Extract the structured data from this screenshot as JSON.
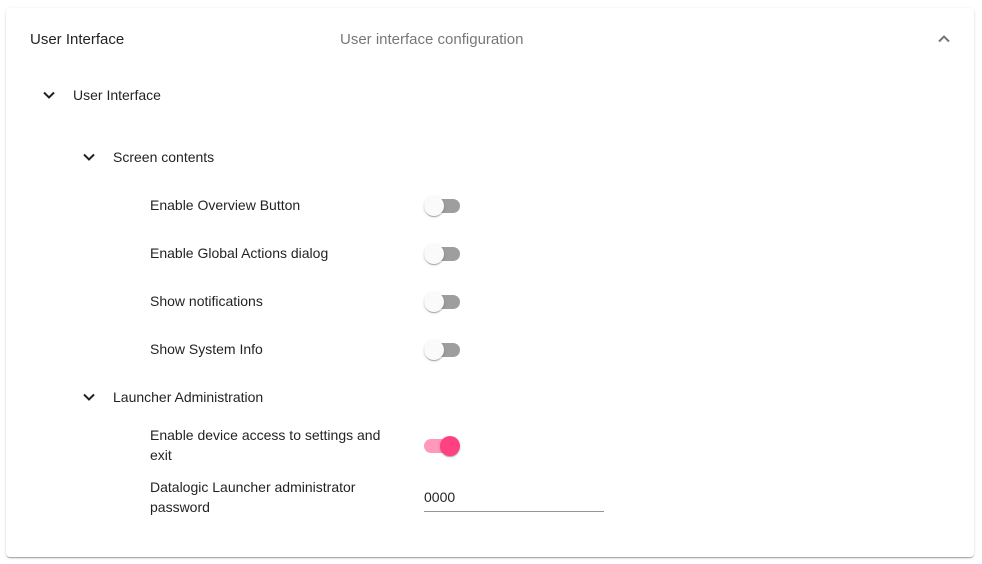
{
  "panel": {
    "title": "User Interface",
    "description": "User interface configuration"
  },
  "group": {
    "label": "User Interface"
  },
  "sections": {
    "screen_contents": {
      "label": "Screen contents",
      "settings": [
        {
          "label": "Enable Overview Button",
          "enabled": false
        },
        {
          "label": "Enable Global Actions dialog",
          "enabled": false
        },
        {
          "label": "Show notifications",
          "enabled": false
        },
        {
          "label": "Show System Info",
          "enabled": false
        }
      ]
    },
    "launcher_admin": {
      "label": "Launcher Administration",
      "device_access_label": "Enable device access to settings and exit",
      "device_access_enabled": true,
      "password_label": "Datalogic Launcher administrator password",
      "password_value": "0000"
    }
  },
  "colors": {
    "accent": "#ff4081",
    "toggle_off_track": "#9e9e9e",
    "thumb_off": "#fafafa"
  },
  "icons": {
    "collapse": "chevron-up-icon",
    "expand": "chevron-down-icon"
  }
}
